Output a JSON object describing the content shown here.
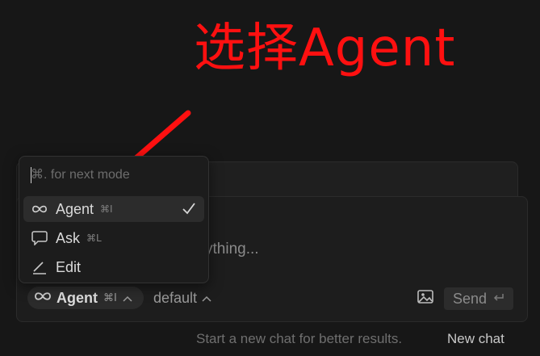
{
  "annotation": {
    "text": "选择Agent",
    "color": "#ff1010"
  },
  "composer": {
    "placeholder_visible": "ything...",
    "mode_button": {
      "icon": "infinity-icon",
      "label": "Agent",
      "shortcut": "⌘I"
    },
    "model_select": {
      "label": "default"
    },
    "send_button": {
      "label": "Send",
      "icon": "enter-icon"
    },
    "image_button": {
      "icon": "image-icon"
    }
  },
  "mode_menu": {
    "search_placeholder": "⌘. for next mode",
    "items": [
      {
        "icon": "infinity-icon",
        "label": "Agent",
        "shortcut": "⌘I",
        "selected": true
      },
      {
        "icon": "chat-bubble-icon",
        "label": "Ask",
        "shortcut": "⌘L",
        "selected": false
      },
      {
        "icon": "pencil-icon",
        "label": "Edit",
        "shortcut": "",
        "selected": false
      }
    ]
  },
  "footer": {
    "hint": "Start a new chat for better results.",
    "new_chat_label": "New chat"
  },
  "colors": {
    "background": "#171717",
    "annotation": "#ff1010",
    "panel": "#1d1d1d",
    "selected_item": "#2c2c2c"
  }
}
